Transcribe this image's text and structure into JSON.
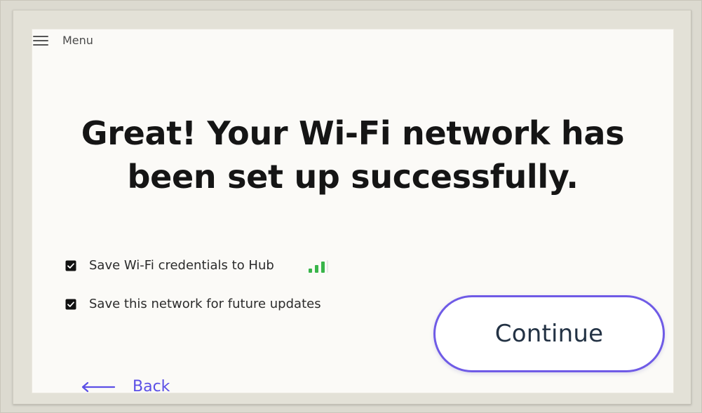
{
  "screen": {
    "menu": {
      "label": "Menu"
    },
    "headline": {
      "line1": "Great! Your Wi-Fi network has",
      "line2": "been set up successfully."
    },
    "options": [
      {
        "label": "Save Wi-Fi credentials to Hub",
        "checked": true
      },
      {
        "label": "Save this network for future updates",
        "checked": true
      }
    ],
    "continue_button": {
      "label": "Continue"
    },
    "back_link": {
      "label": "Back"
    }
  },
  "colors": {
    "accent": "#6f5be6",
    "signal": "#39b54a",
    "text_primary": "#151515",
    "text_secondary": "#2b2b2b"
  },
  "icons": {
    "menu": "menu-icon",
    "checkbox": "checkbox-checked-icon",
    "signal": "signal-strength-icon",
    "back": "back-arrow-icon"
  }
}
